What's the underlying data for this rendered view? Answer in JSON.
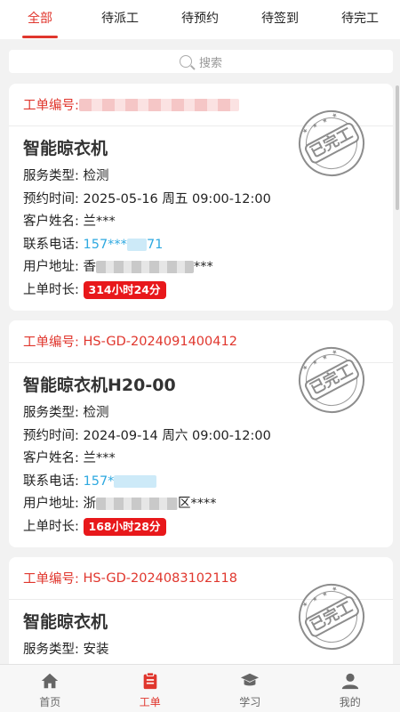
{
  "tabs": [
    "全部",
    "待派工",
    "待预约",
    "待签到",
    "待完工"
  ],
  "search": {
    "placeholder": "搜索"
  },
  "labels": {
    "order_no": "工单编号:",
    "service_type": "服务类型:",
    "appointment": "预约时间:",
    "customer": "客户姓名:",
    "phone": "联系电话:",
    "address": "用户地址:",
    "duration": "上单时长:"
  },
  "stamp_text": "已完工",
  "cards": [
    {
      "order_no": "",
      "title": "智能晾衣机",
      "service_type": "检测",
      "appointment": "2025-05-16 周五 09:00-12:00",
      "customer": "兰***",
      "phone_prefix": "157***",
      "phone_suffix": "71",
      "address_prefix": "香",
      "address_suffix": "***",
      "duration": "314小时24分"
    },
    {
      "order_no": "HS-GD-2024091400412",
      "title": "智能晾衣机H20-00",
      "service_type": "检测",
      "appointment": "2024-09-14 周六 09:00-12:00",
      "customer": "兰***",
      "phone_prefix": "157*",
      "phone_suffix": "",
      "address_prefix": "浙",
      "address_suffix": "区****",
      "duration": "168小时28分"
    },
    {
      "order_no": "HS-GD-2024083102118",
      "title": "智能晾衣机",
      "service_type": "安装"
    }
  ],
  "nav": [
    {
      "label": "首页",
      "icon": "home-icon"
    },
    {
      "label": "工单",
      "icon": "clipboard-icon"
    },
    {
      "label": "学习",
      "icon": "graduation-cap-icon"
    },
    {
      "label": "我的",
      "icon": "user-icon"
    }
  ],
  "colors": {
    "accent": "#e0362d",
    "link": "#2fa9e0",
    "badge": "#e8181b"
  }
}
